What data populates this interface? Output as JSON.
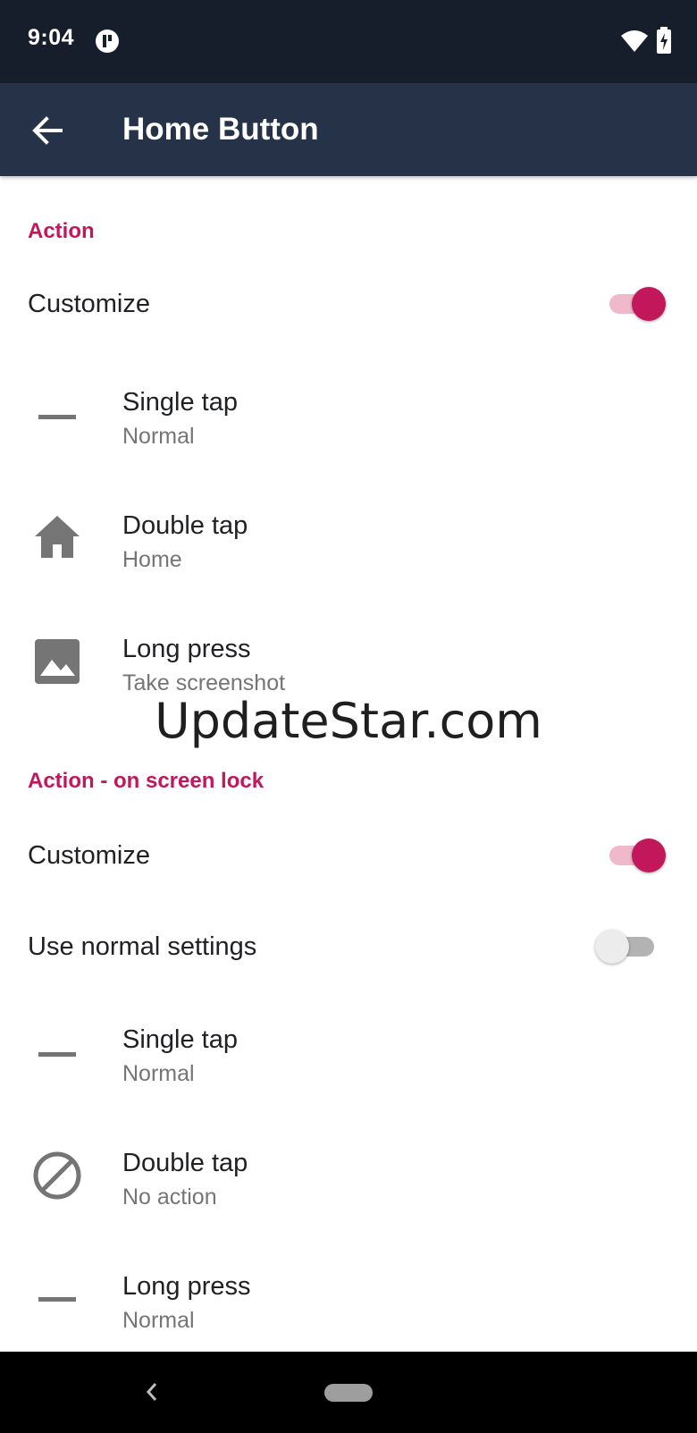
{
  "status_bar": {
    "time": "9:04",
    "icons": [
      "app-notification-icon",
      "wifi-icon",
      "battery-charging-icon"
    ]
  },
  "app_bar": {
    "title": "Home Button",
    "back_icon": "arrow-back-icon"
  },
  "section_action": {
    "header": "Action",
    "customize": {
      "label": "Customize",
      "enabled": true
    },
    "items": [
      {
        "title": "Single tap",
        "summary": "Normal",
        "icon": "dash-icon"
      },
      {
        "title": "Double tap",
        "summary": "Home",
        "icon": "home-icon"
      },
      {
        "title": "Long press",
        "summary": "Take screenshot",
        "icon": "image-icon"
      }
    ]
  },
  "watermark": "UpdateStar.com",
  "section_lock": {
    "header": "Action - on screen lock",
    "customize": {
      "label": "Customize",
      "enabled": true
    },
    "use_normal": {
      "label": "Use normal settings",
      "enabled": false
    },
    "items": [
      {
        "title": "Single tap",
        "summary": "Normal",
        "icon": "dash-icon"
      },
      {
        "title": "Double tap",
        "summary": "No action",
        "icon": "block-icon"
      },
      {
        "title": "Long press",
        "summary": "Normal",
        "icon": "dash-icon"
      }
    ]
  },
  "nav_bar": {
    "icons": [
      "nav-back-icon",
      "nav-home-pill"
    ]
  },
  "colors": {
    "accent": "#c2185b",
    "app_bar": "#263248",
    "status_bar": "#171e2b"
  }
}
